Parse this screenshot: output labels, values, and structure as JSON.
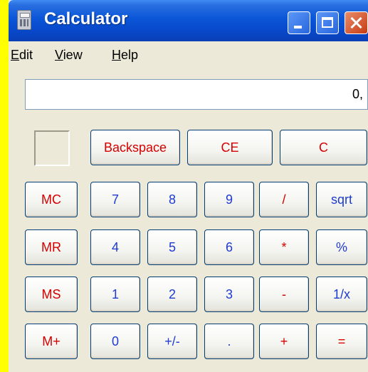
{
  "window": {
    "title": "Calculator",
    "title_icon": "calculator-icon"
  },
  "menu": {
    "items": [
      "Edit",
      "View",
      "Help"
    ]
  },
  "display": {
    "value": "0,"
  },
  "buttons": {
    "backspace": "Backspace",
    "ce": "CE",
    "c": "C",
    "mc": "MC",
    "mr": "MR",
    "ms": "MS",
    "mplus": "M+",
    "n7": "7",
    "n8": "8",
    "n9": "9",
    "div": "/",
    "sqrt": "sqrt",
    "n4": "4",
    "n5": "5",
    "n6": "6",
    "mul": "*",
    "pct": "%",
    "n1": "1",
    "n2": "2",
    "n3": "3",
    "sub": "-",
    "inv": "1/x",
    "n0": "0",
    "sign": "+/-",
    "dot": ".",
    "add": "+",
    "eq": "="
  },
  "colors": {
    "operator": "#d40000",
    "digit": "#1f3bd0",
    "titlebar": "#0a56d8"
  }
}
